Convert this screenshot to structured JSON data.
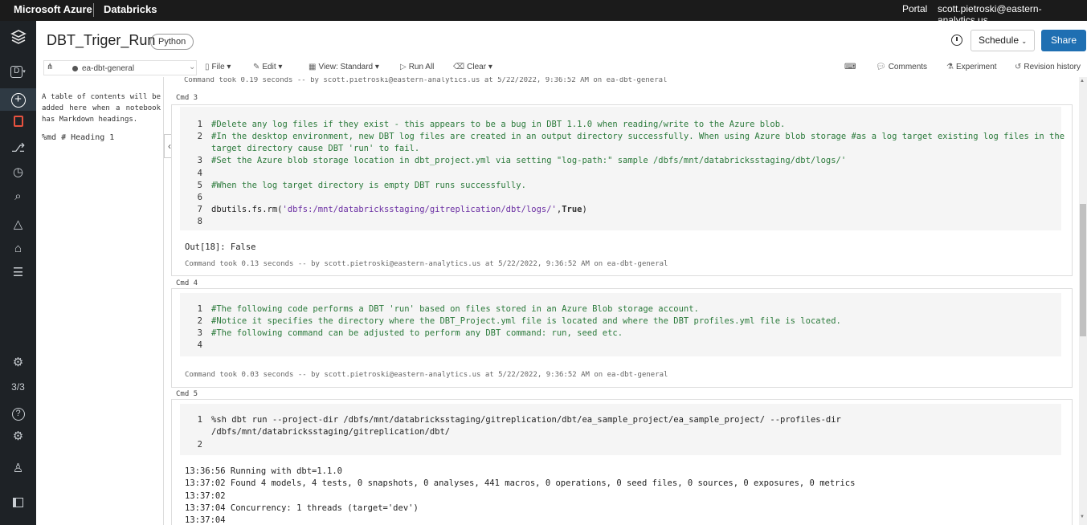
{
  "topbar": {
    "brand": "Microsoft Azure",
    "product": "Databricks",
    "portal": "Portal",
    "user": "scott.pietroski@eastern-analytics.us"
  },
  "leftnav": {
    "workspace_letter": "D",
    "count": "3/3"
  },
  "header": {
    "title": "DBT_Triger_Run",
    "language": "Python",
    "schedule_label": "Schedule",
    "share_label": "Share"
  },
  "toolbar": {
    "cluster": "ea-dbt-general",
    "file": "File",
    "edit": "Edit",
    "view": "View: Standard",
    "run_all": "Run All",
    "clear": "Clear",
    "comments": "Comments",
    "experiment": "Experiment",
    "revision_history": "Revision history"
  },
  "toc": {
    "hint": "A table of contents will be added here when a notebook has Markdown headings.",
    "heading_item": "%md # Heading 1"
  },
  "cells": {
    "prev_took": "Command took 0.19 seconds -- by scott.pietroski@eastern-analytics.us at 5/22/2022, 9:36:52 AM on ea-dbt-general",
    "cmd3": {
      "label": "Cmd 3",
      "l1": "#Delete any log files if they exist - this appears to be a bug in DBT 1.1.0 when reading/write to the Azure blob.",
      "l2a": "#In the desktop environment, new DBT log files are created in an output directory successfully.  When using Azure blob storage #as a log target existing log files in the",
      "l2b": "target directory cause DBT 'run' to fail.",
      "l3": "#Set the Azure blob storage location in dbt_project.yml via setting  \"log-path:\" sample /dbfs/mnt/databricksstaging/dbt/logs/'",
      "l5": "#When the log target directory is empty DBT runs successfully.",
      "l7_fn": "dbutils.fs.rm(",
      "l7_str": "'dbfs:/mnt/databricksstaging/gitreplication/dbt/logs/'",
      "l7_comma": ",",
      "l7_kw": "True",
      "l7_end": ")",
      "out": "Out[18]: False",
      "took": "Command took 0.13 seconds -- by scott.pietroski@eastern-analytics.us at 5/22/2022, 9:36:52 AM on ea-dbt-general"
    },
    "cmd4": {
      "label": "Cmd 4",
      "l1": "#The following code performs a DBT 'run' based on files stored in an Azure Blob storage account.",
      "l2": "#Notice it specifies the directory where the DBT_Project.yml file is located and where the DBT profiles.yml file is located.",
      "l3": "#The following command can be adjusted to perform any DBT command: run, seed etc.",
      "took": "Command took 0.03 seconds -- by scott.pietroski@eastern-analytics.us at 5/22/2022, 9:36:52 AM on ea-dbt-general"
    },
    "cmd5": {
      "label": "Cmd 5",
      "l1a": "%sh dbt run --project-dir /dbfs/mnt/databricksstaging/gitreplication/dbt/ea_sample_project/ea_sample_project/ --profiles-dir",
      "l1b": "/dbfs/mnt/databricksstaging/gitreplication/dbt/",
      "o1": "13:36:56  Running with dbt=1.1.0",
      "o2": "13:37:02  Found 4 models, 4 tests, 0 snapshots, 0 analyses, 441 macros, 0 operations, 0 seed files, 0 sources, 0 exposures, 0 metrics",
      "o3": "13:37:02",
      "o4": "13:37:04  Concurrency: 1 threads (target='dev')",
      "o5": "13:37:04"
    }
  },
  "line_numbers": [
    "1",
    "2",
    "3",
    "4",
    "5",
    "6",
    "7",
    "8"
  ],
  "colors": {
    "topbar": "#1b1b1b",
    "leftnav": "#1e2226",
    "share": "#1f6fb2",
    "comment": "#2b7a3b",
    "string": "#6b2fa3"
  }
}
